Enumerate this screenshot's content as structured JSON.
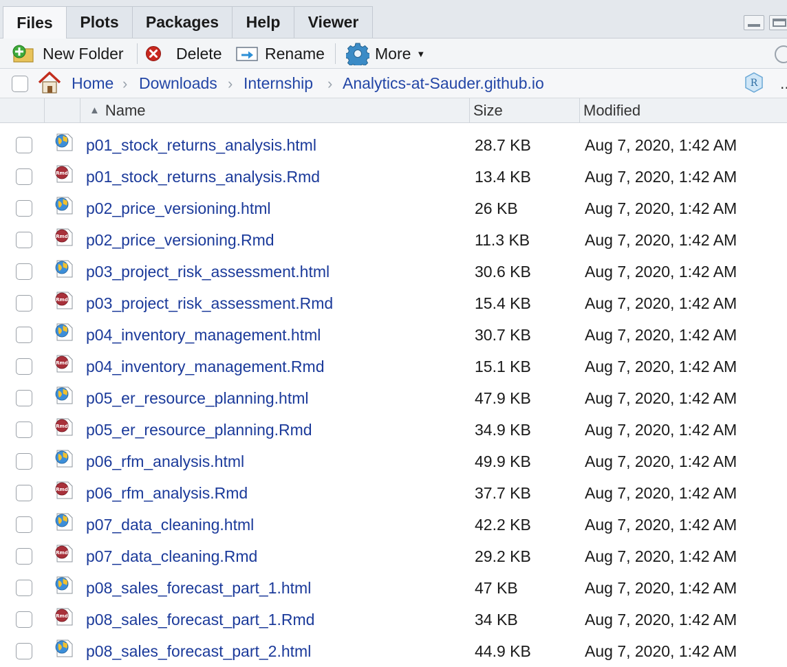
{
  "tabs": [
    {
      "label": "Files",
      "active": true
    },
    {
      "label": "Plots",
      "active": false
    },
    {
      "label": "Packages",
      "active": false
    },
    {
      "label": "Help",
      "active": false
    },
    {
      "label": "Viewer",
      "active": false
    }
  ],
  "toolbar": {
    "new_folder": "New Folder",
    "delete": "Delete",
    "rename": "Rename",
    "more": "More"
  },
  "breadcrumb": {
    "items": [
      "Home",
      "Downloads",
      "Internship",
      "Analytics-at-Sauder.github.io"
    ],
    "overflow": ".."
  },
  "columns": {
    "name": "Name",
    "size": "Size",
    "modified": "Modified"
  },
  "files": [
    {
      "name": "p01_stock_returns_analysis.html",
      "size": "28.7 KB",
      "modified": "Aug 7, 2020, 1:42 AM",
      "type": "html"
    },
    {
      "name": "p01_stock_returns_analysis.Rmd",
      "size": "13.4 KB",
      "modified": "Aug 7, 2020, 1:42 AM",
      "type": "rmd"
    },
    {
      "name": "p02_price_versioning.html",
      "size": "26 KB",
      "modified": "Aug 7, 2020, 1:42 AM",
      "type": "html"
    },
    {
      "name": "p02_price_versioning.Rmd",
      "size": "11.3 KB",
      "modified": "Aug 7, 2020, 1:42 AM",
      "type": "rmd"
    },
    {
      "name": "p03_project_risk_assessment.html",
      "size": "30.6 KB",
      "modified": "Aug 7, 2020, 1:42 AM",
      "type": "html"
    },
    {
      "name": "p03_project_risk_assessment.Rmd",
      "size": "15.4 KB",
      "modified": "Aug 7, 2020, 1:42 AM",
      "type": "rmd"
    },
    {
      "name": "p04_inventory_management.html",
      "size": "30.7 KB",
      "modified": "Aug 7, 2020, 1:42 AM",
      "type": "html"
    },
    {
      "name": "p04_inventory_management.Rmd",
      "size": "15.1 KB",
      "modified": "Aug 7, 2020, 1:42 AM",
      "type": "rmd"
    },
    {
      "name": "p05_er_resource_planning.html",
      "size": "47.9 KB",
      "modified": "Aug 7, 2020, 1:42 AM",
      "type": "html"
    },
    {
      "name": "p05_er_resource_planning.Rmd",
      "size": "34.9 KB",
      "modified": "Aug 7, 2020, 1:42 AM",
      "type": "rmd"
    },
    {
      "name": "p06_rfm_analysis.html",
      "size": "49.9 KB",
      "modified": "Aug 7, 2020, 1:42 AM",
      "type": "html"
    },
    {
      "name": "p06_rfm_analysis.Rmd",
      "size": "37.7 KB",
      "modified": "Aug 7, 2020, 1:42 AM",
      "type": "rmd"
    },
    {
      "name": "p07_data_cleaning.html",
      "size": "42.2 KB",
      "modified": "Aug 7, 2020, 1:42 AM",
      "type": "html"
    },
    {
      "name": "p07_data_cleaning.Rmd",
      "size": "29.2 KB",
      "modified": "Aug 7, 2020, 1:42 AM",
      "type": "rmd"
    },
    {
      "name": "p08_sales_forecast_part_1.html",
      "size": "47 KB",
      "modified": "Aug 7, 2020, 1:42 AM",
      "type": "html"
    },
    {
      "name": "p08_sales_forecast_part_1.Rmd",
      "size": "34 KB",
      "modified": "Aug 7, 2020, 1:42 AM",
      "type": "rmd"
    },
    {
      "name": "p08_sales_forecast_part_2.html",
      "size": "44.9 KB",
      "modified": "Aug 7, 2020, 1:42 AM",
      "type": "html"
    }
  ]
}
